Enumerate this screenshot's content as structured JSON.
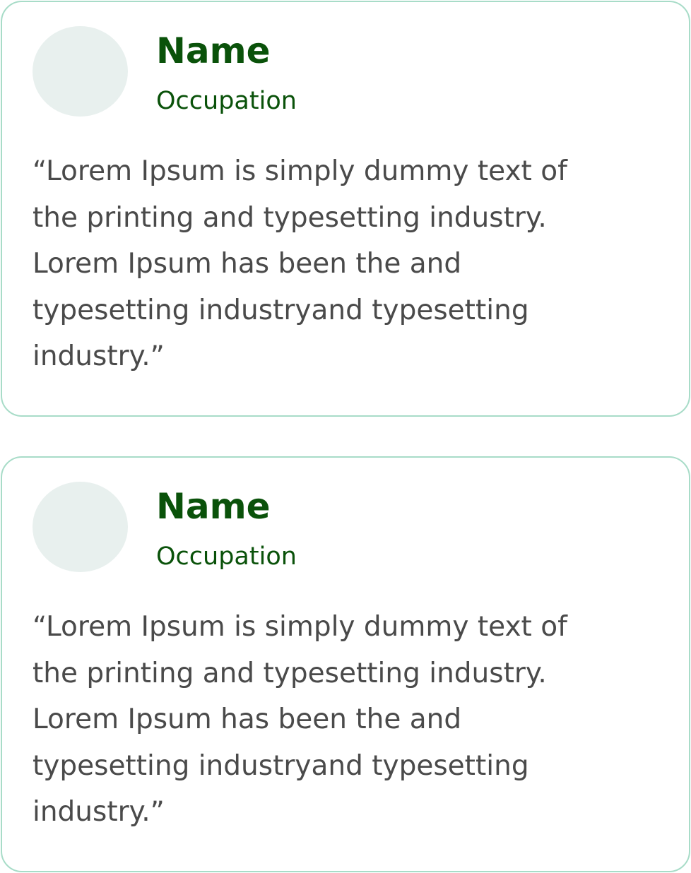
{
  "colors": {
    "name": "#0a520a",
    "occupation": "#0a520a",
    "quote_text": "#4a4a4a",
    "card_border": "#a8dcc8",
    "avatar": "#e8f0ee"
  },
  "testimonials": [
    {
      "name": "Name",
      "occupation": "Occupation",
      "quote_lines": [
        "“Lorem Ipsum is simply dummy text of",
        "the printing and typesetting industry.",
        "Lorem Ipsum has been the and",
        "typesetting industryand typesetting",
        "industry.”"
      ]
    },
    {
      "name": "Name",
      "occupation": "Occupation",
      "quote_lines": [
        "“Lorem Ipsum is simply dummy text of",
        "the printing and typesetting industry.",
        "Lorem Ipsum has been the and",
        "typesetting industryand typesetting",
        "industry.”"
      ]
    }
  ]
}
